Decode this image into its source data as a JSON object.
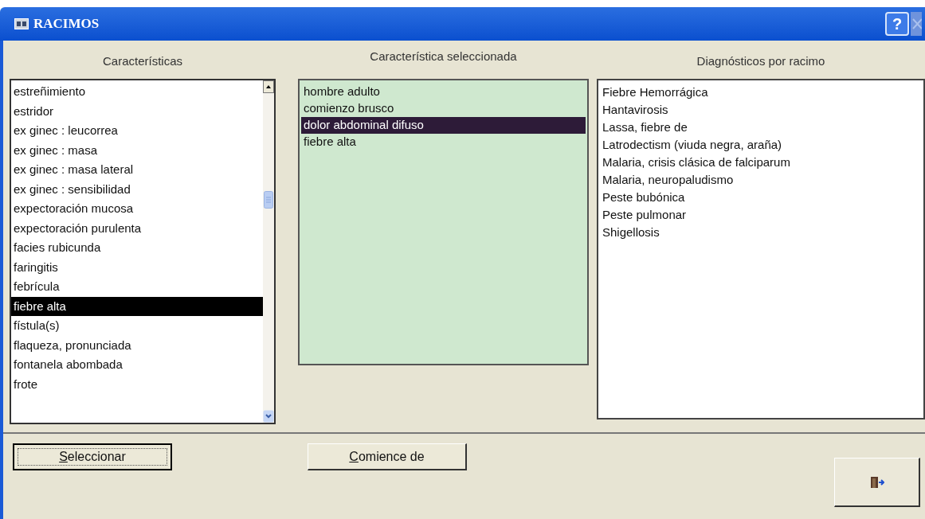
{
  "window": {
    "title": "RACIMOS",
    "help_button": "?"
  },
  "columns": [
    {
      "heading": "Características",
      "kind": "scroll-list",
      "items": [
        {
          "label": "estreñimiento",
          "selected": false
        },
        {
          "label": "estridor",
          "selected": false
        },
        {
          "label": "ex ginec : leucorrea",
          "selected": false
        },
        {
          "label": "ex ginec : masa",
          "selected": false
        },
        {
          "label": "ex ginec : masa lateral",
          "selected": false
        },
        {
          "label": "ex ginec : sensibilidad",
          "selected": false
        },
        {
          "label": "expectoración mucosa",
          "selected": false
        },
        {
          "label": "expectoración purulenta",
          "selected": false
        },
        {
          "label": "facies rubicunda",
          "selected": false
        },
        {
          "label": "faringitis",
          "selected": false
        },
        {
          "label": "febrícula",
          "selected": false
        },
        {
          "label": "fiebre alta",
          "selected": true
        },
        {
          "label": "fístula(s)",
          "selected": false
        },
        {
          "label": "flaqueza, pronunciada",
          "selected": false
        },
        {
          "label": "fontanela abombada",
          "selected": false
        },
        {
          "label": "frote",
          "selected": false
        }
      ]
    },
    {
      "heading": "Característica seleccionada",
      "kind": "green-list",
      "items": [
        {
          "label": "hombre adulto",
          "selected": false
        },
        {
          "label": "comienzo brusco",
          "selected": false
        },
        {
          "label": "dolor abdominal difuso",
          "selected": true
        },
        {
          "label": "fiebre alta",
          "selected": false
        }
      ]
    },
    {
      "heading": "Diagnósticos por racimo",
      "kind": "plain-list",
      "items": [
        {
          "label": "Fiebre Hemorrágica",
          "selected": false
        },
        {
          "label": "Hantavirosis",
          "selected": false
        },
        {
          "label": "Lassa, fiebre de",
          "selected": false
        },
        {
          "label": "Latrodectism (viuda negra, araña)",
          "selected": false
        },
        {
          "label": "Malaria, crisis clásica de falciparum",
          "selected": false
        },
        {
          "label": "Malaria, neuropaludismo",
          "selected": false
        },
        {
          "label": "Peste bubónica",
          "selected": false
        },
        {
          "label": "Peste pulmonar",
          "selected": false
        },
        {
          "label": "Shigellosis",
          "selected": false
        }
      ]
    }
  ],
  "buttons": [
    {
      "label": "Seleccionar",
      "focused": true
    },
    {
      "label": "Comience de",
      "focused": false
    }
  ]
}
